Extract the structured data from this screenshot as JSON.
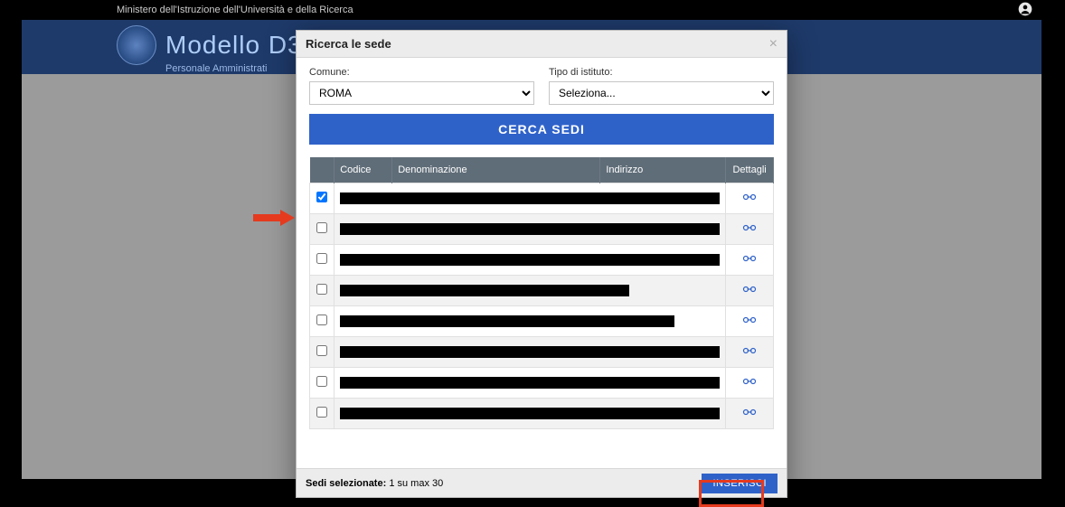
{
  "topbar": {
    "ministry": "Ministero dell'Istruzione dell'Università e della Ricerca"
  },
  "brand": {
    "title": "Modello D3",
    "subtitle": "Personale Amministrati"
  },
  "modal": {
    "title": "Ricerca le sede",
    "filters": {
      "comune_label": "Comune:",
      "comune_value": "ROMA",
      "tipo_label": "Tipo di istituto:",
      "tipo_value": "Seleziona..."
    },
    "search_button": "CERCA SEDI",
    "columns": {
      "codice": "Codice",
      "denominazione": "Denominazione",
      "indirizzo": "Indirizzo",
      "dettagli": "Dettagli"
    },
    "rows": [
      {
        "checked": true,
        "redact_w": 420
      },
      {
        "checked": false,
        "redact_w": 420
      },
      {
        "checked": false,
        "redact_w": 420
      },
      {
        "checked": false,
        "redact_w": 320
      },
      {
        "checked": false,
        "redact_w": 370
      },
      {
        "checked": false,
        "redact_w": 420
      },
      {
        "checked": false,
        "redact_w": 420
      },
      {
        "checked": false,
        "redact_w": 420
      }
    ],
    "footer": {
      "selected_label": "Sedi selezionate:",
      "selected_count": "1 su max 30",
      "insert": "INSERISCI"
    }
  }
}
